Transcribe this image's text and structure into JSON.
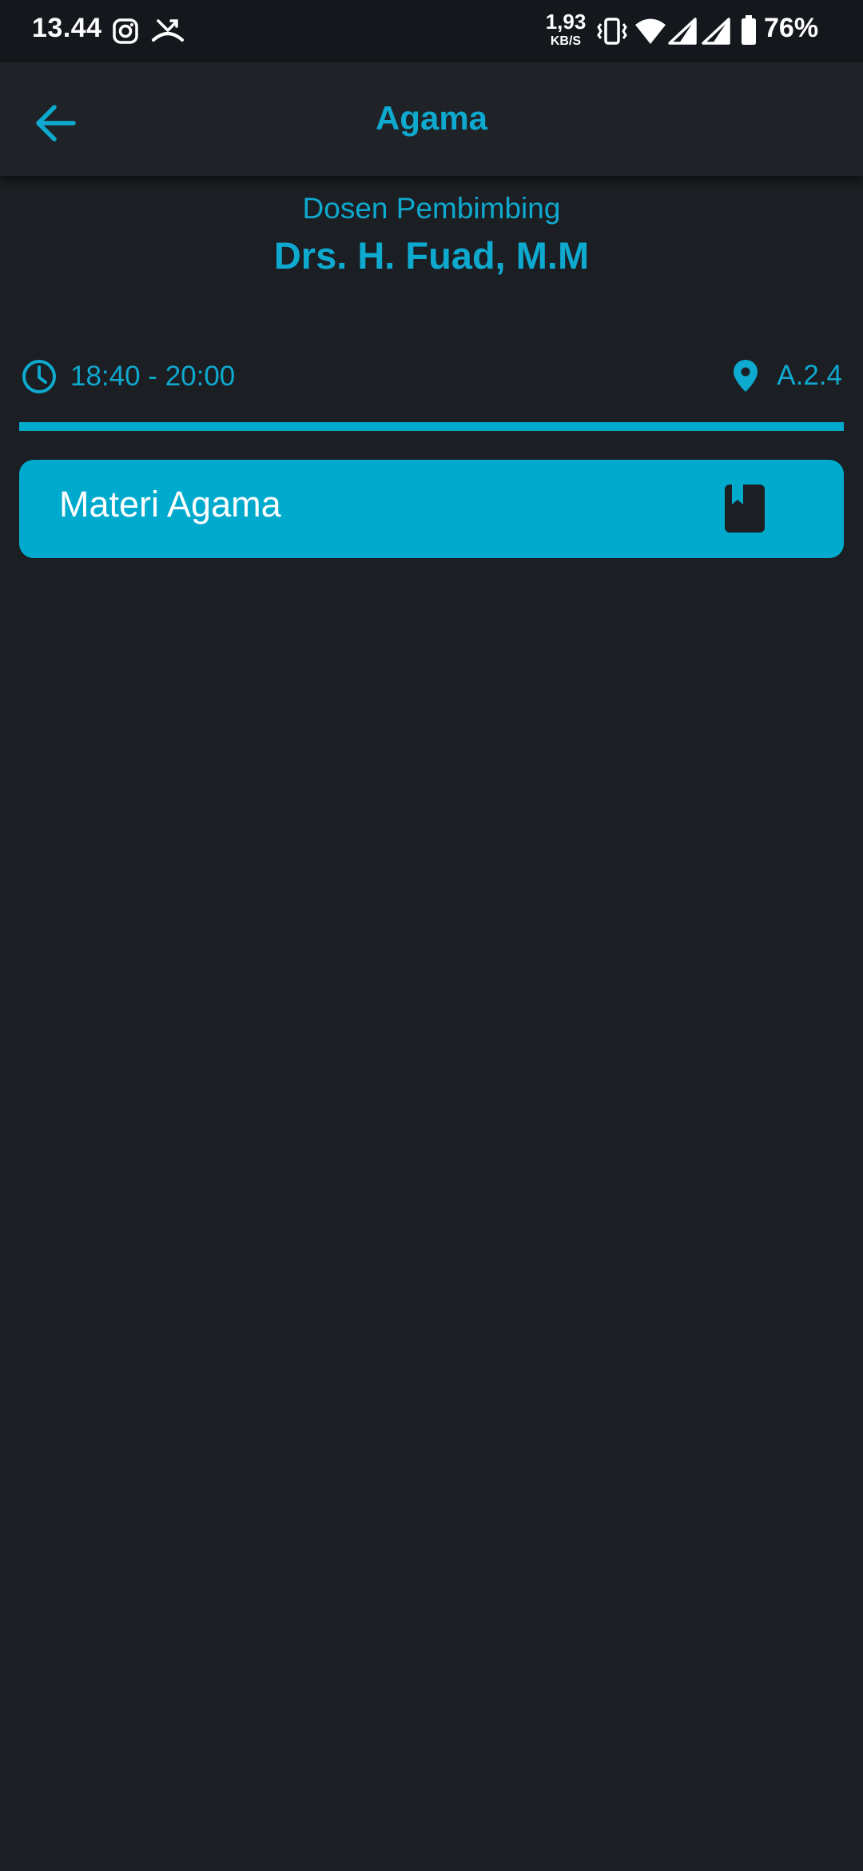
{
  "status_bar": {
    "time": "13.44",
    "net_speed_value": "1,93",
    "net_speed_unit": "KB/S",
    "battery_percent": "76%",
    "icons": [
      "instagram-icon",
      "missed-call-icon",
      "vibrate-icon",
      "wifi-icon",
      "signal-icon",
      "signal-icon",
      "battery-icon"
    ]
  },
  "app_bar": {
    "title": "Agama",
    "back_icon": "arrow-left-icon"
  },
  "lecturer": {
    "label": "Dosen Pembimbing",
    "name": "Drs. H. Fuad, M.M"
  },
  "schedule": {
    "time": "18:40 - 20:00",
    "time_icon": "clock-icon",
    "room": "A.2.4",
    "room_icon": "location-pin-icon"
  },
  "materials": [
    {
      "label": "Materi Agama",
      "icon": "book-icon"
    }
  ],
  "colors": {
    "accent": "#00aacd",
    "background": "#1b1e22",
    "app_bar": "#1f2327",
    "status_bar": "#14171b"
  }
}
